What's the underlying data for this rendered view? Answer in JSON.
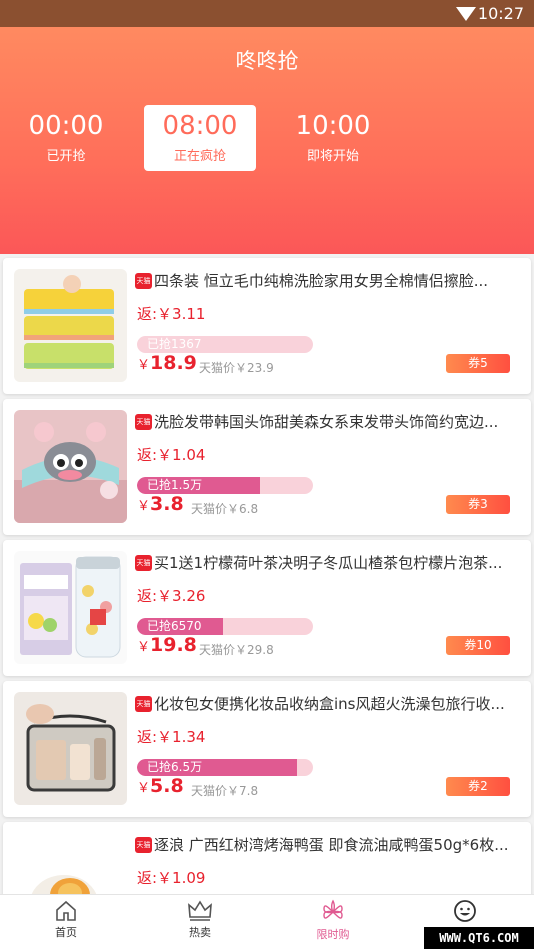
{
  "status_bar": {
    "time": "10:27",
    "wifi_icon": "wifi-icon"
  },
  "header": {
    "title": "咚咚抢",
    "slots": [
      {
        "time": "00:00",
        "label": "已开抢"
      },
      {
        "time": "08:00",
        "label": "正在疯抢"
      },
      {
        "time": "10:00",
        "label": "即将开始"
      }
    ]
  },
  "products": [
    {
      "name": "四条装  恒立毛巾纯棉洗脸家用女男全棉情侣擦脸...",
      "rebate": "返:￥3.11",
      "sold": "已抢1367",
      "sold_fraction": 0.0,
      "price_symbol": "￥",
      "price": "18.9",
      "orig": "天猫价￥23.9",
      "coupon": "券5"
    },
    {
      "name": "洗脸发带韩国头饰甜美森女系束发带头饰简约宽边...",
      "rebate": "返:￥1.04",
      "sold": "已抢1.5万",
      "sold_fraction": 0.7,
      "price_symbol": "￥",
      "price": "3.8",
      "orig": "天猫价￥6.8",
      "coupon": "券3"
    },
    {
      "name": "买1送1柠檬荷叶茶决明子冬瓜山楂茶包柠檬片泡茶...",
      "rebate": "返:￥3.26",
      "sold": "已抢6570",
      "sold_fraction": 0.49,
      "price_symbol": "￥",
      "price": "19.8",
      "orig": "天猫价￥29.8",
      "coupon": "券10"
    },
    {
      "name": "化妆包女便携化妆品收纳盒ins风超火洗澡包旅行收...",
      "rebate": "返:￥1.34",
      "sold": "已抢6.5万",
      "sold_fraction": 0.91,
      "price_symbol": "￥",
      "price": "5.8",
      "orig": "天猫价￥7.8",
      "coupon": "券2"
    },
    {
      "name": "逐浪 广西红树湾烤海鸭蛋 即食流油咸鸭蛋50g*6枚...",
      "rebate": "返:￥1.09"
    }
  ],
  "tmall_badge": "天猫",
  "tabs": [
    {
      "label": "首页",
      "icon": "home-icon"
    },
    {
      "label": "热卖",
      "icon": "crown-icon"
    },
    {
      "label": "限时购",
      "icon": "flower-icon"
    },
    {
      "label": "",
      "icon": "smiley-icon"
    }
  ],
  "watermark": "WWW.QT6.COM",
  "colors": {
    "accent": "#e05a91",
    "price": "#e8222e",
    "header_top": "#ff8a60",
    "header_bottom": "#fb5758"
  }
}
